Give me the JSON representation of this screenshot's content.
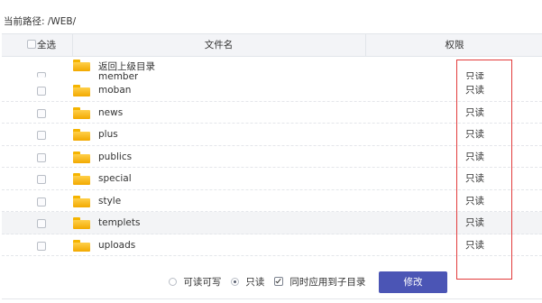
{
  "path_label": "当前路径: /WEB/",
  "header": {
    "select_all": "全选",
    "filename": "文件名",
    "permission": "权限"
  },
  "parent_dir": {
    "label": "返回上级目录"
  },
  "rows": [
    {
      "name": "member",
      "perm": "只读",
      "highlighted": false
    },
    {
      "name": "moban",
      "perm": "只读",
      "highlighted": false
    },
    {
      "name": "news",
      "perm": "只读",
      "highlighted": false
    },
    {
      "name": "plus",
      "perm": "只读",
      "highlighted": false
    },
    {
      "name": "publics",
      "perm": "只读",
      "highlighted": false
    },
    {
      "name": "special",
      "perm": "只读",
      "highlighted": false
    },
    {
      "name": "style",
      "perm": "只读",
      "highlighted": false
    },
    {
      "name": "templets",
      "perm": "只读",
      "highlighted": true
    },
    {
      "name": "uploads",
      "perm": "只读",
      "highlighted": false
    }
  ],
  "footer": {
    "option_rw": "可读可写",
    "option_ro": "只读",
    "apply_children": "同时应用到子目录",
    "submit": "修改"
  },
  "colors": {
    "accent": "#4b55b5",
    "annotation": "#e23b3b",
    "folder": "#f5b400"
  }
}
